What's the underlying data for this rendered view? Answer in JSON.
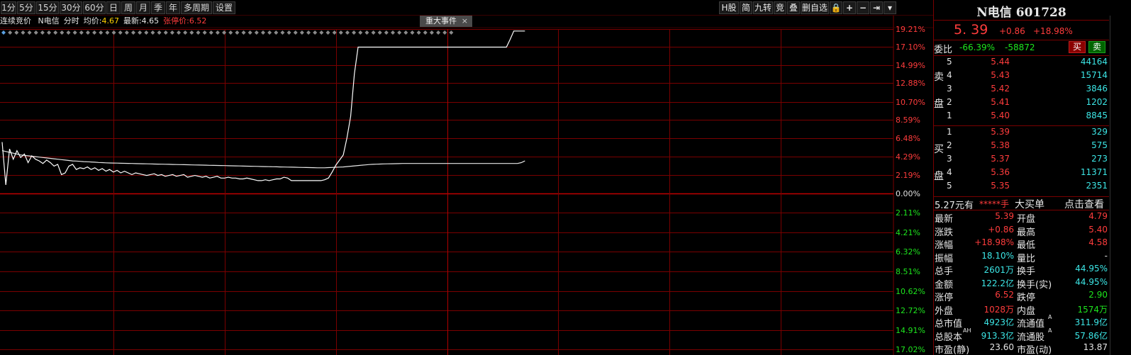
{
  "toolbar": {
    "periods": [
      "1分",
      "5分",
      "15分",
      "30分",
      "60分",
      "日",
      "周",
      "月",
      "季",
      "年",
      "多周期",
      "设置"
    ],
    "right_buttons": [
      "H股",
      "简",
      "九转",
      "竞",
      "叠",
      "删自选"
    ],
    "right_icons": [
      "lock-icon",
      "plus-icon",
      "minus-icon",
      "arrow-right-bar-icon",
      "dropdown-icon"
    ]
  },
  "info": {
    "mode": "连续竞价",
    "name": "N电信",
    "type": "分时",
    "avg_label": "均价:",
    "avg": "4.67",
    "latest_label": "最新:",
    "latest": "4.65",
    "limit_label": "张停价:",
    "limit": "6.52",
    "event": "重大事件",
    "event_close": "×"
  },
  "chart_data": {
    "type": "line",
    "y_labels_up": [
      "19.21%",
      "17.10%",
      "14.99%",
      "12.88%",
      "10.70%",
      "8.59%",
      "6.48%",
      "4.29%",
      "2.19%",
      "0.00%"
    ],
    "y_labels_down": [
      "2.11%",
      "4.21%",
      "6.32%",
      "8.51%",
      "10.62%",
      "12.72%",
      "14.91%",
      "17.02%"
    ],
    "ylim": [
      -18.0,
      20.0
    ],
    "x_total_minutes": 240,
    "series": [
      {
        "values": [
          6.0,
          1.0,
          5.2,
          4.0,
          5.0,
          4.2,
          4.6,
          3.6,
          4.4,
          4.0,
          3.8,
          3.5,
          3.9,
          3.6,
          3.2,
          3.4,
          2.2,
          2.4,
          3.2,
          3.4,
          2.8,
          3.0,
          2.9,
          3.1,
          2.8,
          3.0,
          2.7,
          2.9,
          2.6,
          2.8,
          2.5,
          2.7,
          2.4,
          2.6,
          2.4,
          2.2,
          2.4,
          2.3,
          2.2,
          2.1,
          2.2,
          2.3,
          2.1,
          2.2,
          2.0,
          2.1,
          2.2,
          2.0,
          2.1,
          2.2,
          1.9,
          2.0,
          2.1,
          2.0,
          1.9,
          2.0,
          1.8,
          1.9,
          2.0,
          1.8,
          1.8,
          1.9,
          1.8,
          1.8,
          1.7,
          1.7,
          1.8,
          1.7,
          1.6,
          1.5,
          1.5,
          1.6,
          1.5,
          1.6,
          1.7,
          1.7,
          1.9,
          1.8,
          1.5,
          1.5,
          1.5,
          1.5,
          1.5,
          1.5,
          1.5,
          1.5,
          1.5,
          1.6,
          1.8,
          2.5,
          3.3,
          3.9,
          4.5,
          6.5,
          9.0,
          14.0,
          17.1,
          17.1,
          17.1,
          17.1,
          17.1,
          17.1,
          17.1,
          17.1,
          17.1,
          17.1,
          17.1,
          17.1,
          17.1,
          17.1,
          17.1,
          17.1,
          17.1,
          17.1,
          17.1,
          17.1,
          17.1,
          17.1,
          17.1,
          17.1,
          17.1,
          17.1,
          17.1,
          17.1,
          17.1,
          17.1,
          17.1,
          17.1,
          17.1,
          17.1,
          17.1,
          17.1,
          17.1,
          17.1,
          17.1,
          17.1,
          17.1,
          18.0,
          18.98,
          18.98,
          18.98,
          18.98
        ]
      },
      {
        "values": [
          5.0,
          4.9,
          4.8,
          4.7,
          4.6,
          4.5,
          4.45,
          4.4,
          4.35,
          4.3,
          4.25,
          4.2,
          4.15,
          4.1,
          4.05,
          4.0,
          3.95,
          3.9,
          3.85,
          3.8,
          3.78,
          3.75,
          3.72,
          3.7,
          3.68,
          3.65,
          3.62,
          3.6,
          3.58,
          3.56,
          3.55,
          3.54,
          3.53,
          3.52,
          3.51,
          3.5,
          3.49,
          3.48,
          3.47,
          3.46,
          3.45,
          3.44,
          3.43,
          3.42,
          3.41,
          3.4,
          3.39,
          3.38,
          3.37,
          3.36,
          3.35,
          3.34,
          3.33,
          3.32,
          3.31,
          3.3,
          3.29,
          3.28,
          3.27,
          3.26,
          3.25,
          3.24,
          3.23,
          3.22,
          3.21,
          3.2,
          3.19,
          3.18,
          3.17,
          3.16,
          3.15,
          3.14,
          3.13,
          3.12,
          3.11,
          3.1,
          3.09,
          3.08,
          3.07,
          3.06,
          3.05,
          3.04,
          3.03,
          3.02,
          3.01,
          3.0,
          3.0,
          3.0,
          3.02,
          3.04,
          3.06,
          3.08,
          3.1,
          3.14,
          3.18,
          3.22,
          3.26,
          3.3,
          3.34,
          3.38,
          3.4,
          3.42,
          3.44,
          3.45,
          3.46,
          3.47,
          3.48,
          3.49,
          3.5,
          3.5,
          3.5,
          3.5,
          3.5,
          3.5,
          3.5,
          3.5,
          3.5,
          3.5,
          3.5,
          3.5,
          3.5,
          3.5,
          3.5,
          3.5,
          3.5,
          3.5,
          3.5,
          3.5,
          3.5,
          3.5,
          3.5,
          3.5,
          3.5,
          3.5,
          3.5,
          3.5,
          3.5,
          3.5,
          3.5,
          3.5,
          3.6,
          3.8
        ]
      }
    ]
  },
  "quote": {
    "name": "N电信",
    "code": "601728",
    "price": "5. 39",
    "change": "+0.86",
    "pct": "+18.98%",
    "weibi_label": "委比",
    "weibi_pct": "-66.39%",
    "weibi_diff": "-58872",
    "buy_btn": "买",
    "sell_btn": "卖",
    "sell_side_label_1": "卖",
    "sell_side_label_2": "盘",
    "buy_side_label_1": "买",
    "buy_side_label_2": "盘",
    "sells": [
      {
        "level": "5",
        "price": "5.44",
        "vol": "44164"
      },
      {
        "level": "4",
        "price": "5.43",
        "vol": "15714"
      },
      {
        "level": "3",
        "price": "5.42",
        "vol": "3846"
      },
      {
        "level": "2",
        "price": "5.41",
        "vol": "1202"
      },
      {
        "level": "1",
        "price": "5.40",
        "vol": "8845"
      }
    ],
    "buys": [
      {
        "level": "1",
        "price": "5.39",
        "vol": "329"
      },
      {
        "level": "2",
        "price": "5.38",
        "vol": "575"
      },
      {
        "level": "3",
        "price": "5.37",
        "vol": "273"
      },
      {
        "level": "4",
        "price": "5.36",
        "vol": "11371"
      },
      {
        "level": "5",
        "price": "5.35",
        "vol": "2351"
      }
    ],
    "bigbuy_price": "5.27元有",
    "bigbuy_mask": "*****手",
    "bigbuy_label": "大买单",
    "bigbuy_link": "点击查看",
    "stats": [
      {
        "l1": "最新",
        "v1": "5.39",
        "c1": "red",
        "l2": "开盘",
        "v2": "4.79",
        "c2": "red"
      },
      {
        "l1": "涨跌",
        "v1": "+0.86",
        "c1": "red",
        "l2": "最高",
        "v2": "5.40",
        "c2": "red"
      },
      {
        "l1": "涨幅",
        "v1": "+18.98%",
        "c1": "red",
        "l2": "最低",
        "v2": "4.58",
        "c2": "red"
      },
      {
        "l1": "振幅",
        "v1": "18.10%",
        "c1": "cyan",
        "l2": "量比",
        "v2": "-",
        "c2": "white"
      },
      {
        "l1": "总手",
        "v1": "2601万",
        "c1": "cyan",
        "l2": "换手",
        "v2": "44.95%",
        "c2": "cyan"
      },
      {
        "l1": "金额",
        "v1": "122.2亿",
        "c1": "cyan",
        "l2": "换手(实)",
        "v2": "44.95%",
        "c2": "cyan"
      },
      {
        "l1": "涨停",
        "v1": "6.52",
        "c1": "red",
        "l2": "跌停",
        "v2": "2.90",
        "c2": "green"
      },
      {
        "l1": "外盘",
        "v1": "1028万",
        "c1": "red",
        "l2": "内盘",
        "v2": "1574万",
        "c2": "green"
      },
      {
        "l1": "总市值",
        "v1": "4923亿",
        "c1": "cyan",
        "l2": "流通值",
        "v2": "311.9亿",
        "c2": "cyan"
      },
      {
        "l1": "总股本",
        "v1": "913.3亿",
        "c1": "cyan",
        "l2": "流通股",
        "v2": "57.86亿",
        "c2": "cyan"
      },
      {
        "l1": "市盈(静)",
        "v1": "23.60",
        "c1": "white",
        "l2": "市盈(动)",
        "v2": "13.87",
        "c2": "white"
      }
    ],
    "sup_ah": "AH",
    "sup_a": "A"
  },
  "colors": {
    "up": "#ff3c3c",
    "down": "#1ee61e",
    "grid": "#7a0000",
    "price_line": "#ffffff",
    "avg_line": "#e6e6e6",
    "diamond": "#5aa0e0"
  }
}
